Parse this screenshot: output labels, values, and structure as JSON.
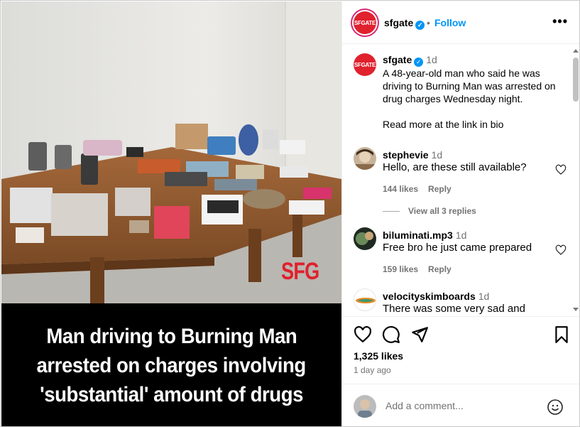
{
  "post": {
    "caption_lines": [
      "Man driving to Burning Man",
      "arrested on charges involving",
      "'substantial' amount of drugs"
    ],
    "watermark": "SFG"
  },
  "header": {
    "logo_text": "SFGATE",
    "username": "sfgate",
    "separator": "•",
    "follow_label": "Follow",
    "more_label": "•••"
  },
  "caption": {
    "username": "sfgate",
    "time": "1d",
    "text": "A 48-year-old man who said he was driving to Burning Man was arrested on drug charges Wednesday night.",
    "text2": "Read more at the link in bio"
  },
  "comments": [
    {
      "username": "stephevie",
      "time": "1d",
      "text": "Hello, are these still available?",
      "likes": "144 likes",
      "reply": "Reply"
    },
    {
      "username": "biluminati.mp3",
      "time": "1d",
      "text": "Free bro he just came prepared",
      "likes": "159 likes",
      "reply": "Reply"
    },
    {
      "username": "velocityskimboards",
      "time": "1d",
      "text": "There was some very sad and"
    }
  ],
  "view_replies": "View all 3 replies",
  "actions": {
    "likes": "1,325 likes",
    "date": "1 day ago"
  },
  "add_comment": {
    "placeholder": "Add a comment..."
  },
  "colors": {
    "accent": "#0095f6",
    "brand": "#e0212e",
    "muted": "#737373"
  }
}
